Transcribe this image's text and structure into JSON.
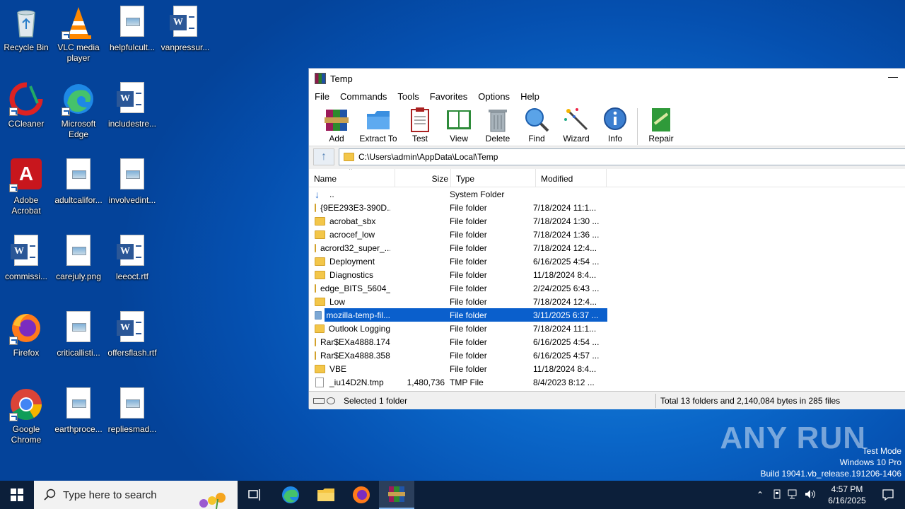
{
  "desktop_icons": [
    {
      "label": "Recycle Bin"
    },
    {
      "label": "VLC media player"
    },
    {
      "label": "helpfulcult..."
    },
    {
      "label": "vanpressur..."
    },
    {
      "label": "CCleaner"
    },
    {
      "label": "Microsoft Edge"
    },
    {
      "label": "includestre..."
    },
    {
      "label": "Adobe Acrobat"
    },
    {
      "label": "adultcalifor..."
    },
    {
      "label": "involvedint..."
    },
    {
      "label": "commissi..."
    },
    {
      "label": "carejuly.png"
    },
    {
      "label": "leeoct.rtf"
    },
    {
      "label": "Firefox"
    },
    {
      "label": "criticallisti..."
    },
    {
      "label": "offersflash.rtf"
    },
    {
      "label": "Google Chrome"
    },
    {
      "label": "earthproce..."
    },
    {
      "label": "repliesmad..."
    }
  ],
  "window": {
    "title": "Temp",
    "minimize": "—",
    "menu": [
      "File",
      "Commands",
      "Tools",
      "Favorites",
      "Options",
      "Help"
    ],
    "toolbar": [
      {
        "label": "Add"
      },
      {
        "label": "Extract To"
      },
      {
        "label": "Test"
      },
      {
        "label": "View"
      },
      {
        "label": "Delete"
      },
      {
        "label": "Find"
      },
      {
        "label": "Wizard"
      },
      {
        "label": "Info"
      },
      {
        "label": "Repair"
      }
    ],
    "up_arrow": "↑",
    "address": "C:\\Users\\admin\\AppData\\Local\\Temp",
    "columns": {
      "name": "Name",
      "size": "Size",
      "type": "Type",
      "modified": "Modified"
    },
    "rows": [
      {
        "name": "..",
        "size": "",
        "type": "System Folder",
        "modified": "",
        "kind": "up"
      },
      {
        "name": "{9EE293E3-390D...",
        "size": "",
        "type": "File folder",
        "modified": "7/18/2024 11:1..."
      },
      {
        "name": "acrobat_sbx",
        "size": "",
        "type": "File folder",
        "modified": "7/18/2024 1:30 ..."
      },
      {
        "name": "acrocef_low",
        "size": "",
        "type": "File folder",
        "modified": "7/18/2024 1:36 ..."
      },
      {
        "name": "acrord32_super_...",
        "size": "",
        "type": "File folder",
        "modified": "7/18/2024 12:4..."
      },
      {
        "name": "Deployment",
        "size": "",
        "type": "File folder",
        "modified": "6/16/2025 4:54 ..."
      },
      {
        "name": "Diagnostics",
        "size": "",
        "type": "File folder",
        "modified": "11/18/2024 8:4..."
      },
      {
        "name": "edge_BITS_5604_...",
        "size": "",
        "type": "File folder",
        "modified": "2/24/2025 6:43 ..."
      },
      {
        "name": "Low",
        "size": "",
        "type": "File folder",
        "modified": "7/18/2024 12:4..."
      },
      {
        "name": "mozilla-temp-fil...",
        "size": "",
        "type": "File folder",
        "modified": "3/11/2025 6:37 ...",
        "selected": true
      },
      {
        "name": "Outlook Logging",
        "size": "",
        "type": "File folder",
        "modified": "7/18/2024 11:1..."
      },
      {
        "name": "Rar$EXa4888.174...",
        "size": "",
        "type": "File folder",
        "modified": "6/16/2025 4:54 ..."
      },
      {
        "name": "Rar$EXa4888.358...",
        "size": "",
        "type": "File folder",
        "modified": "6/16/2025 4:57 ..."
      },
      {
        "name": "VBE",
        "size": "",
        "type": "File folder",
        "modified": "11/18/2024 8:4..."
      },
      {
        "name": "_iu14D2N.tmp",
        "size": "1,480,736",
        "type": "TMP File",
        "modified": "8/4/2023 8:12 ...",
        "kind": "file"
      }
    ],
    "status_left": "Selected 1 folder",
    "status_right": "Total 13 folders and 2,140,084 bytes in 285 files"
  },
  "watermark": {
    "brand": "ANY RUN",
    "mode": "Test Mode",
    "os": "Windows 10 Pro",
    "build": "Build 19041.vb_release.191206-1406"
  },
  "taskbar": {
    "search_placeholder": "Type here to search",
    "time": "4:57 PM",
    "date": "6/16/2025"
  }
}
